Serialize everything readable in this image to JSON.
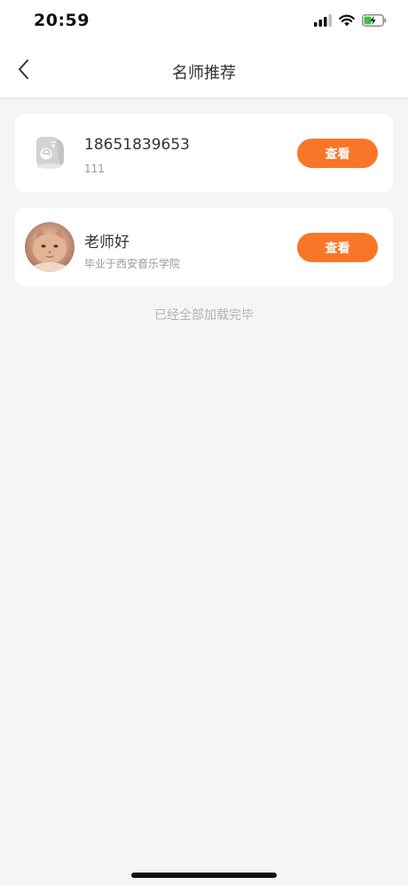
{
  "status_bar": {
    "time": "20:59",
    "icons": [
      "signal-icon",
      "wifi-icon",
      "battery-charging-icon"
    ]
  },
  "nav": {
    "title": "名师推荐",
    "back_icon": "chevron-left-icon"
  },
  "teachers": [
    {
      "name": "18651839653",
      "description": "111",
      "avatar": "default-avatar-icon",
      "button_label": "查看"
    },
    {
      "name": "老师好",
      "description": "毕业于西安音乐学院",
      "avatar": "cat-photo-avatar",
      "button_label": "查看"
    }
  ],
  "footer_tip": "已经全部加载完毕",
  "colors": {
    "accent": "#f97528",
    "background": "#f5f5f5",
    "card": "#ffffff"
  }
}
